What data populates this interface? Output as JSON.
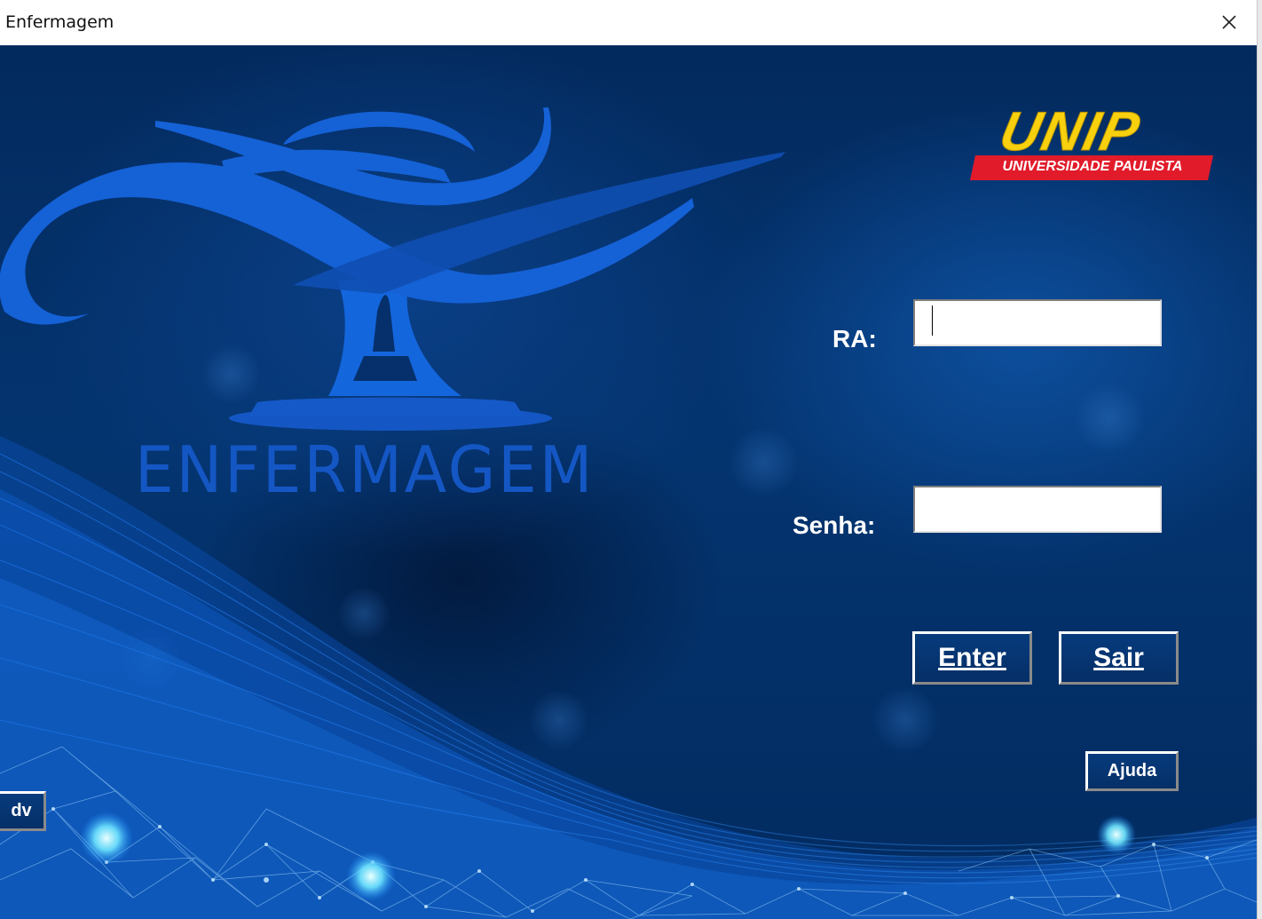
{
  "window": {
    "title": "Enfermagem",
    "close_icon": "close-icon"
  },
  "branding": {
    "course_word": "ENFERMAGEM",
    "university_logo_word": "UNIP",
    "university_logo_subtitle": "UNIVERSIDADE PAULISTA",
    "emblem_icon": "nursing-lamp-icon"
  },
  "form": {
    "ra_label": "RA:",
    "ra_value": "",
    "senha_label": "Senha:",
    "senha_value": ""
  },
  "buttons": {
    "enter": "Enter",
    "sair": "Sair",
    "ajuda": "Ajuda",
    "dv": "dv"
  },
  "colors": {
    "background": "#04346f",
    "logo_blue": "#1457c4",
    "unip_yellow": "#f8d00e",
    "unip_red": "#e11b2a"
  }
}
